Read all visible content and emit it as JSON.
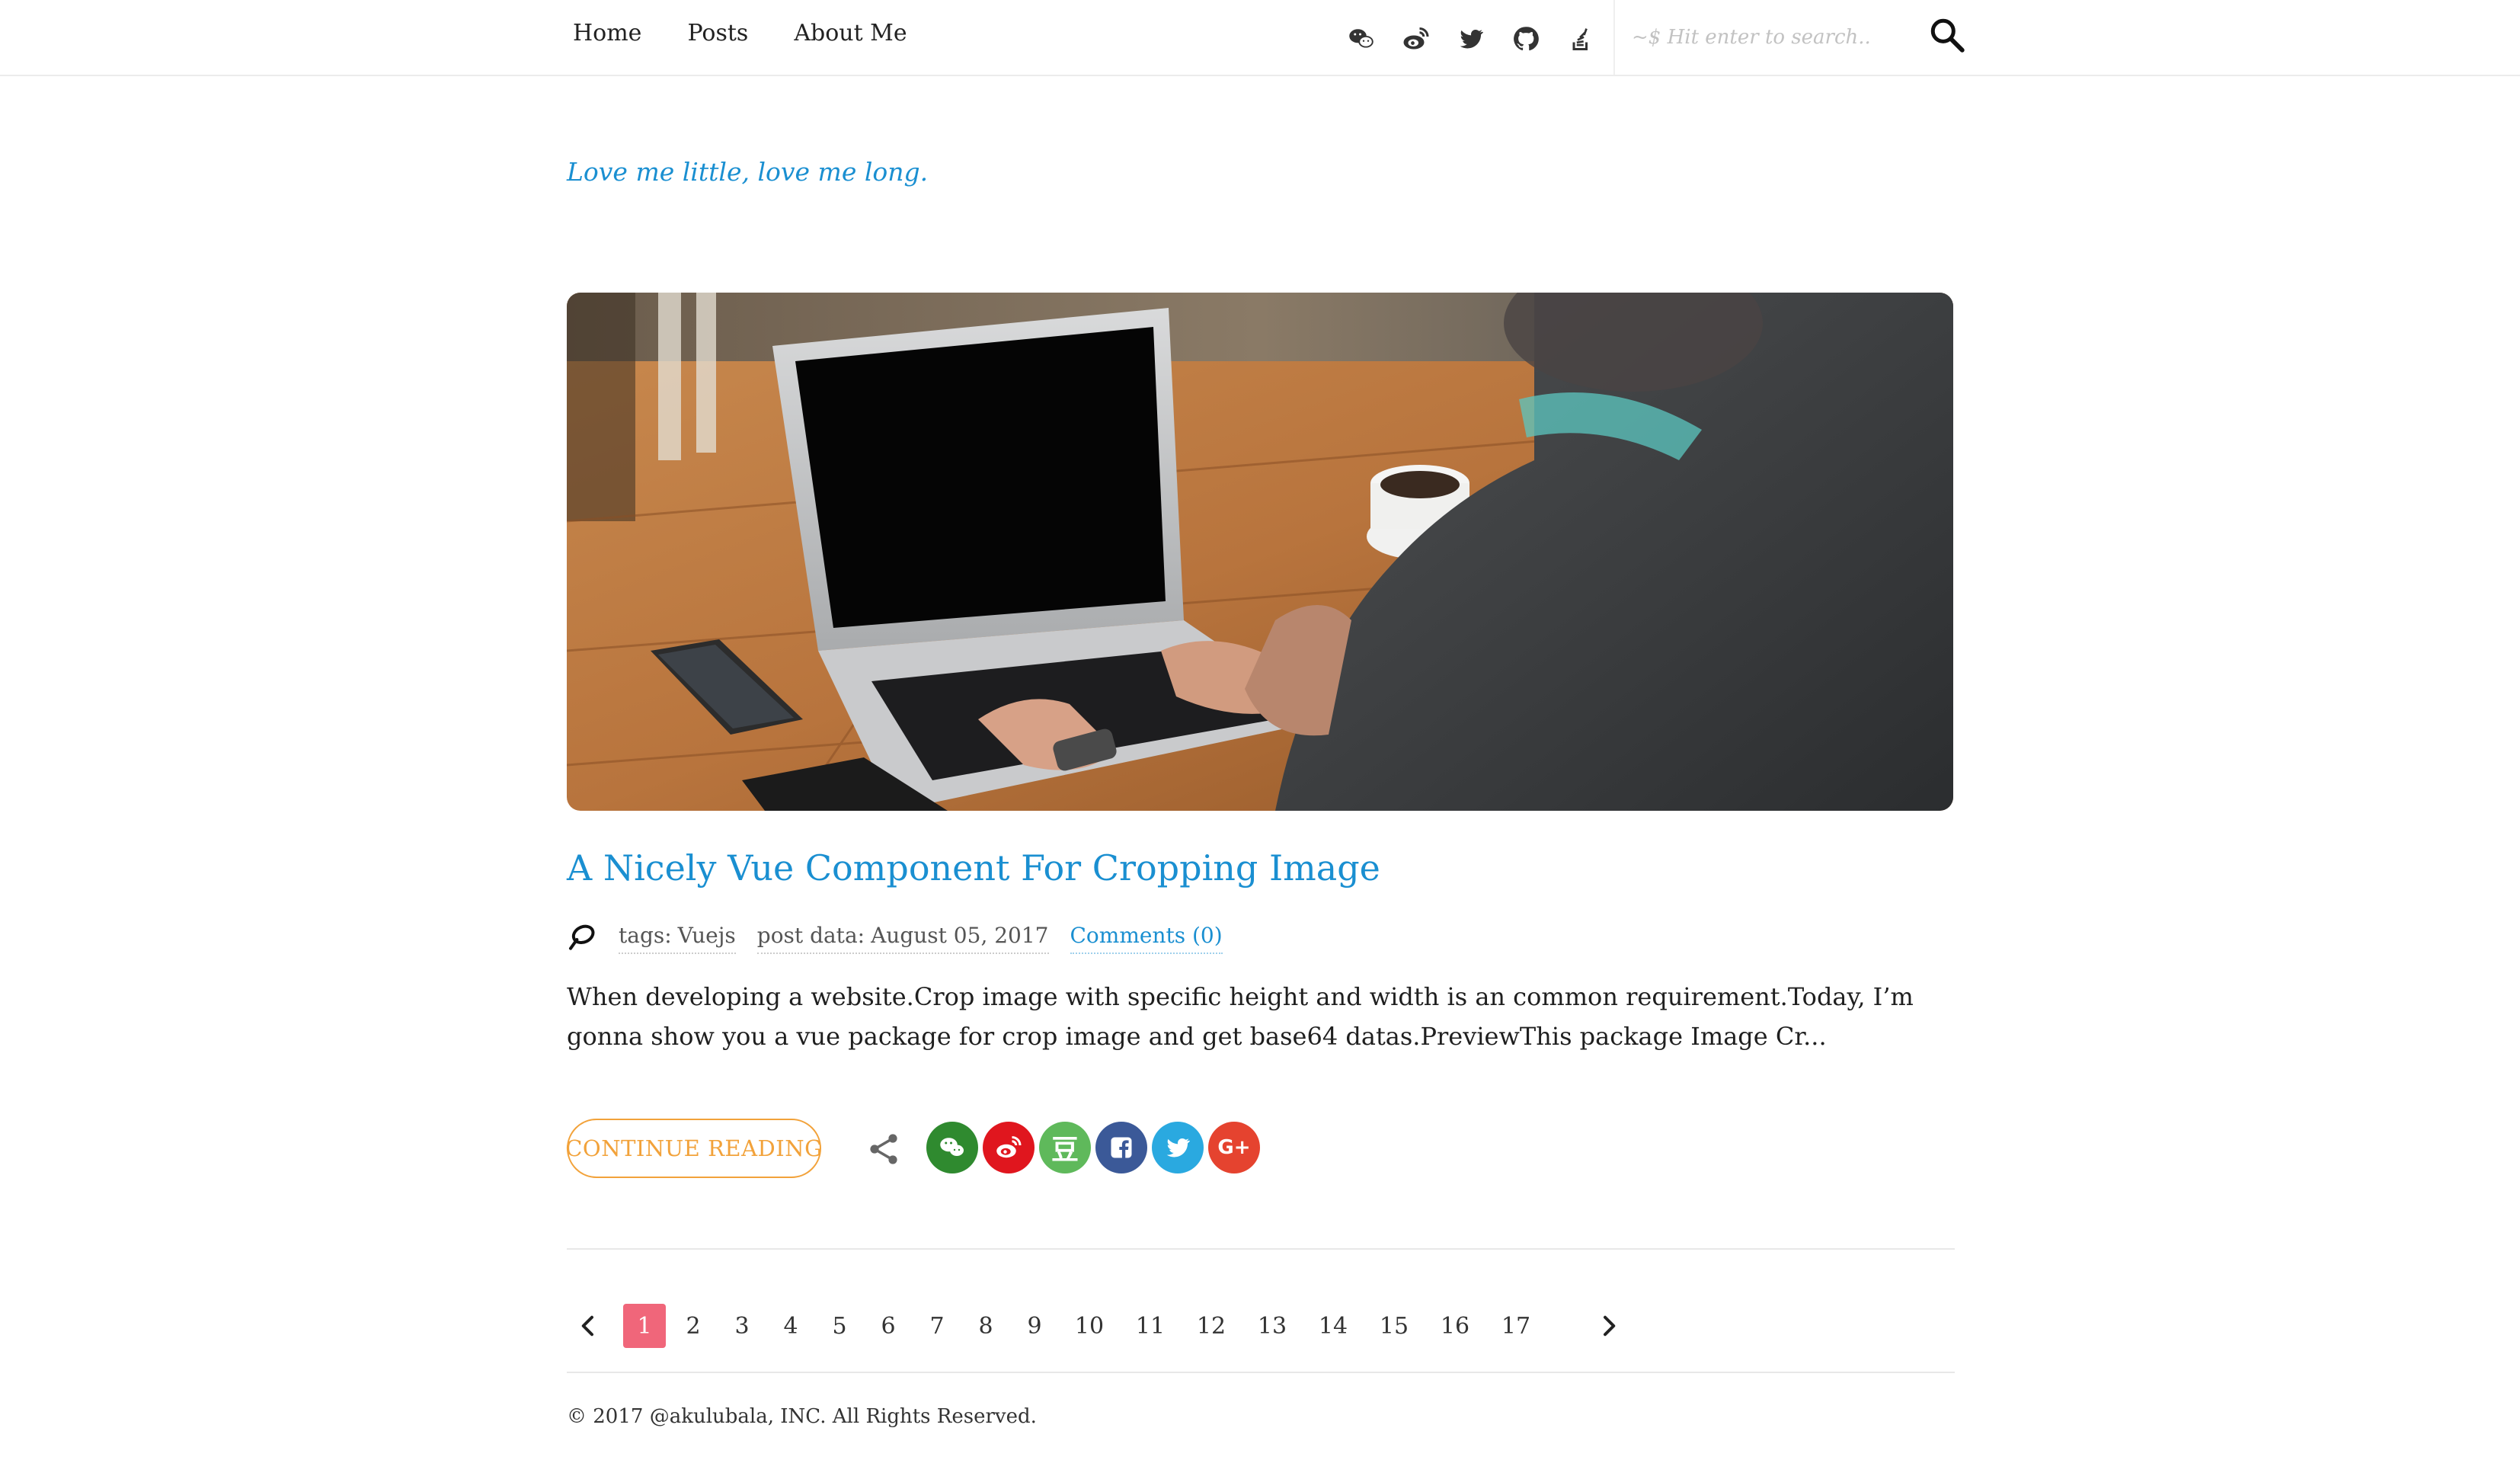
{
  "nav": {
    "items": [
      "Home",
      "Posts",
      "About Me"
    ],
    "social_icons": [
      "wechat-icon",
      "weibo-icon",
      "twitter-icon",
      "github-icon",
      "stackoverflow-icon"
    ],
    "search": {
      "placeholder": "~$ Hit enter to search..",
      "value": ""
    }
  },
  "motto": "Love me little, love me long.",
  "post": {
    "title": "A Nicely Vue Component For Cropping Image",
    "tags_label": "tags:",
    "tag": "Vuejs",
    "date_label": "post data:",
    "date": "August 05, 2017",
    "comments": "Comments (0)",
    "excerpt": "When developing a website.Crop image with specific height and width is an common requirement.Today, I’m gonna show you a vue package for crop image and get base64 datas.PreviewThis package Image Cr...",
    "continue_label": "CONTINUE READING",
    "share_buttons": [
      {
        "name": "wechat",
        "color": "#2f8a2f"
      },
      {
        "name": "weibo",
        "color": "#e0161e"
      },
      {
        "name": "douban",
        "color": "#5fb95b"
      },
      {
        "name": "facebook",
        "color": "#3b5998"
      },
      {
        "name": "twitter",
        "color": "#2aa9e0"
      },
      {
        "name": "google-plus",
        "color": "#e5432f"
      }
    ],
    "share_labels": {
      "douban": "豆",
      "google_plus": "G+"
    }
  },
  "pagination": {
    "current": "1",
    "pages": [
      "1",
      "2",
      "3",
      "4",
      "5",
      "6",
      "7",
      "8",
      "9",
      "10",
      "11",
      "12",
      "13",
      "14",
      "15",
      "16",
      "17"
    ]
  },
  "footer": {
    "copyright": "© 2017 @akulubala, INC. All Rights Reserved."
  },
  "colors": {
    "link": "#1a8fd1",
    "accent": "#f2a23a",
    "active_page": "#f0667a"
  }
}
